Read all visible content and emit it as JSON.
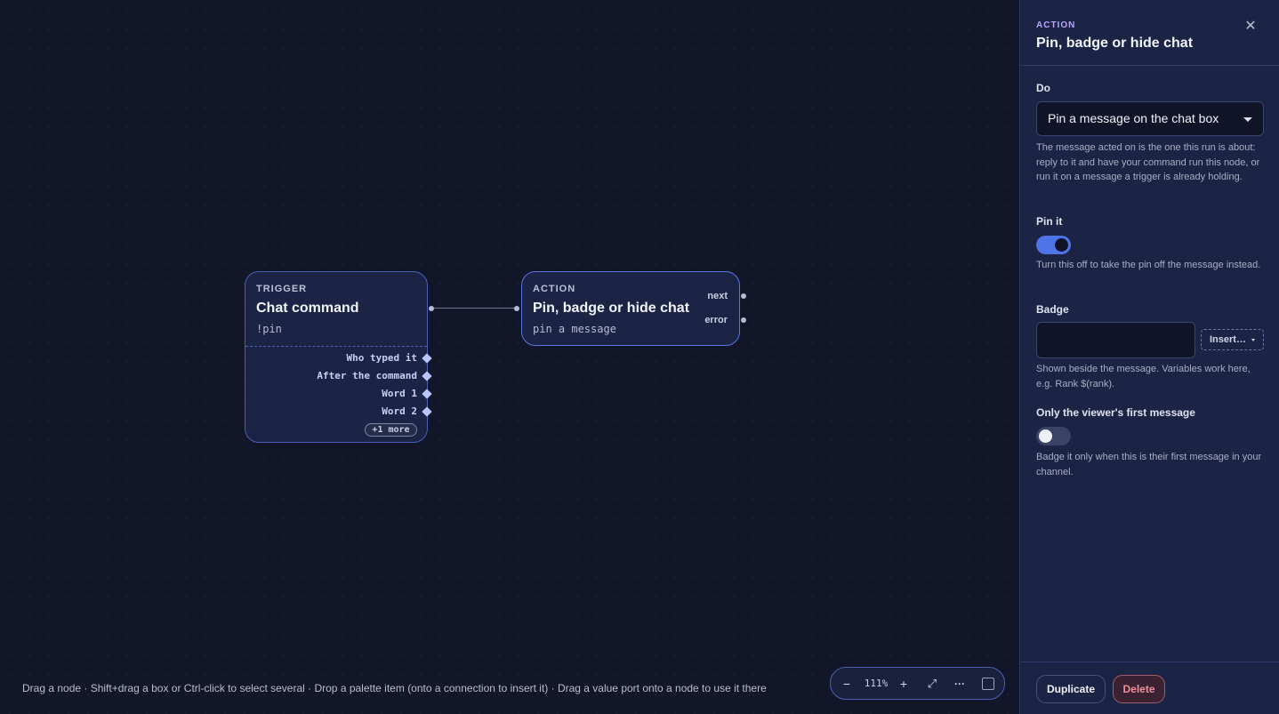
{
  "trigger_node": {
    "kind": "TRIGGER",
    "title": "Chat command",
    "subtitle": "!pin",
    "value_ports": [
      "Who typed it",
      "After the command",
      "Word 1",
      "Word 2"
    ],
    "more_label": "+1 more"
  },
  "action_node": {
    "kind": "ACTION",
    "title": "Pin, badge or hide chat",
    "subtitle": "pin a message",
    "outputs": {
      "next": "next",
      "error": "error"
    }
  },
  "canvas": {
    "hint": "Drag a node · Shift+drag a box or Ctrl-click to select several · Drop a palette item (onto a connection to insert it) · Drag a value port onto a node to use it there"
  },
  "zoombar": {
    "zoom_out": "−",
    "zoom_level": "111%",
    "zoom_in": "+",
    "fit": "⤢",
    "more": "···"
  },
  "inspector": {
    "kind": "ACTION",
    "title": "Pin, badge or hide chat",
    "close_glyph": "✕",
    "do_label": "Do",
    "do_value": "Pin a message on the chat box",
    "do_help": "The message acted on is the one this run is about: reply to it and have your command run this node, or run it on a message a trigger is already holding.",
    "pin_label": "Pin it",
    "pin_on": true,
    "pin_help": "Turn this off to take the pin off the message instead.",
    "badge_label": "Badge",
    "badge_value": "",
    "insert_label": "Insert…",
    "badge_help": "Shown beside the message. Variables work here, e.g. Rank $(rank).",
    "first_label": "Only the viewer's first message",
    "first_on": false,
    "first_help": "Badge it only when this is their first message in your channel.",
    "duplicate_label": "Duplicate",
    "delete_label": "Delete"
  },
  "colors": {
    "canvas_bg": "#111629",
    "node_bg": "#1b2444",
    "node_border": "#4a5fb5",
    "accent": "#4e74e8",
    "kind_accent": "#b9a6ff",
    "danger": "#f08f98"
  }
}
